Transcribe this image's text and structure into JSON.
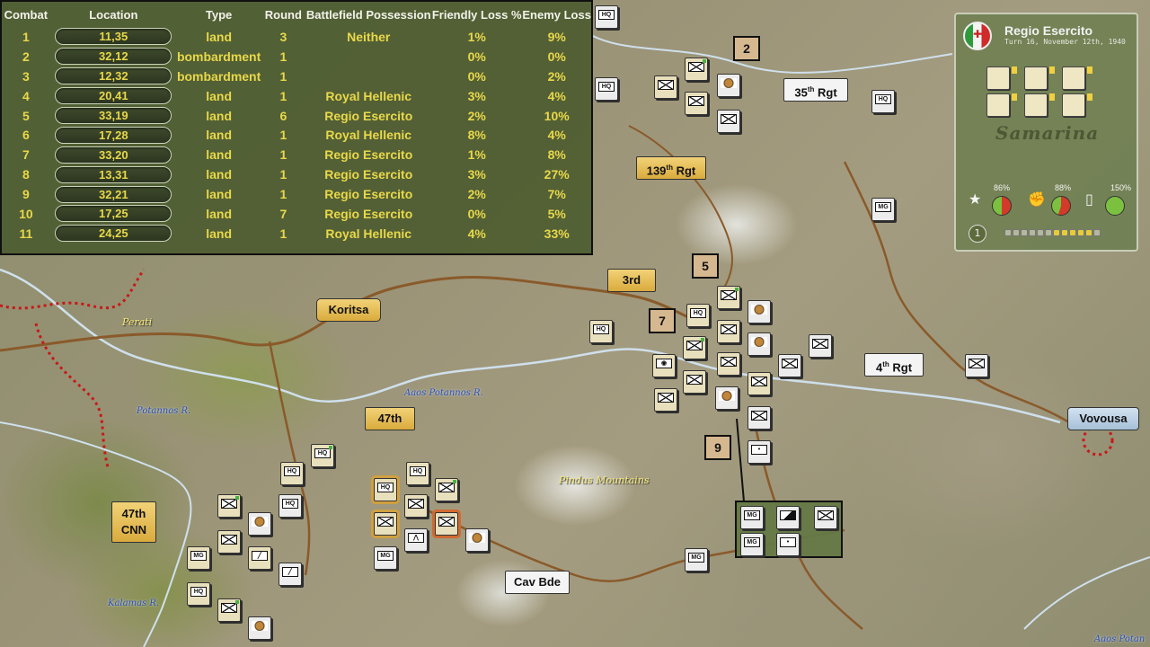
{
  "combat_table": {
    "headers": {
      "combat": "Combat",
      "location": "Location",
      "type": "Type",
      "round": "Round",
      "possession": "Battlefield Possession",
      "friendly_loss": "Friendly Loss %",
      "enemy_loss": "Enemy Loss"
    },
    "rows": [
      {
        "n": "1",
        "loc": "11,35",
        "type": "land",
        "round": "3",
        "poss": "Neither",
        "fl": "1%",
        "el": "9%"
      },
      {
        "n": "2",
        "loc": "32,12",
        "type": "bombardment",
        "round": "1",
        "poss": "",
        "fl": "0%",
        "el": "0%"
      },
      {
        "n": "3",
        "loc": "12,32",
        "type": "bombardment",
        "round": "1",
        "poss": "",
        "fl": "0%",
        "el": "2%"
      },
      {
        "n": "4",
        "loc": "20,41",
        "type": "land",
        "round": "1",
        "poss": "Royal Hellenic",
        "fl": "3%",
        "el": "4%"
      },
      {
        "n": "5",
        "loc": "33,19",
        "type": "land",
        "round": "6",
        "poss": "Regio Esercito",
        "fl": "2%",
        "el": "10%"
      },
      {
        "n": "6",
        "loc": "17,28",
        "type": "land",
        "round": "1",
        "poss": "Royal Hellenic",
        "fl": "8%",
        "el": "4%"
      },
      {
        "n": "7",
        "loc": "33,20",
        "type": "land",
        "round": "1",
        "poss": "Regio Esercito",
        "fl": "1%",
        "el": "8%"
      },
      {
        "n": "8",
        "loc": "13,31",
        "type": "land",
        "round": "1",
        "poss": "Regio Esercito",
        "fl": "3%",
        "el": "27%"
      },
      {
        "n": "9",
        "loc": "32,21",
        "type": "land",
        "round": "1",
        "poss": "Regio Esercito",
        "fl": "2%",
        "el": "7%"
      },
      {
        "n": "10",
        "loc": "17,25",
        "type": "land",
        "round": "7",
        "poss": "Regio Esercito",
        "fl": "0%",
        "el": "5%"
      },
      {
        "n": "11",
        "loc": "24,25",
        "type": "land",
        "round": "1",
        "poss": "Royal Hellenic",
        "fl": "4%",
        "el": "33%"
      }
    ]
  },
  "info_panel": {
    "faction": "Regio Esercito",
    "turn": "Turn 16, November 12th, 1940",
    "place": "Samarina",
    "stat_morale": "86%",
    "stat_supply": "88%",
    "stat_fuel": "150%",
    "level": "1",
    "turn_dots_total": 12,
    "turn_dots_on": 5,
    "colors": {
      "accent": "#e6cc3a",
      "panel": "#708052"
    }
  },
  "map": {
    "number_boxes": [
      "2",
      "5",
      "7",
      "9"
    ],
    "labels": {
      "rgt35_num": "35",
      "rgt35_sup": "th",
      "rgt35_txt": " Rgt",
      "rgt139_num": "139",
      "rgt139_sup": "th",
      "rgt139_txt": " Rgt",
      "third": "3rd",
      "koritsa": "Koritsa",
      "rgt4_num": "4",
      "rgt4_sup": "th",
      "rgt4_txt": " Rgt",
      "vovousa": "Vovousa",
      "forty_seventh": "47th",
      "cnn_line1": "47th",
      "cnn_line2": "CNN",
      "cav_bde": "Cav Bde"
    },
    "places": {
      "perati": "Perati",
      "pindus": "Pindus Mountains"
    },
    "rivers": {
      "aaos": "Aaos Potannos R.",
      "potannos": "Potannos R.",
      "kalamas": "Kalamas R.",
      "aaos_edge": "Aaos Potan"
    },
    "units": {
      "hq": "HQ",
      "mg": "MG"
    }
  }
}
